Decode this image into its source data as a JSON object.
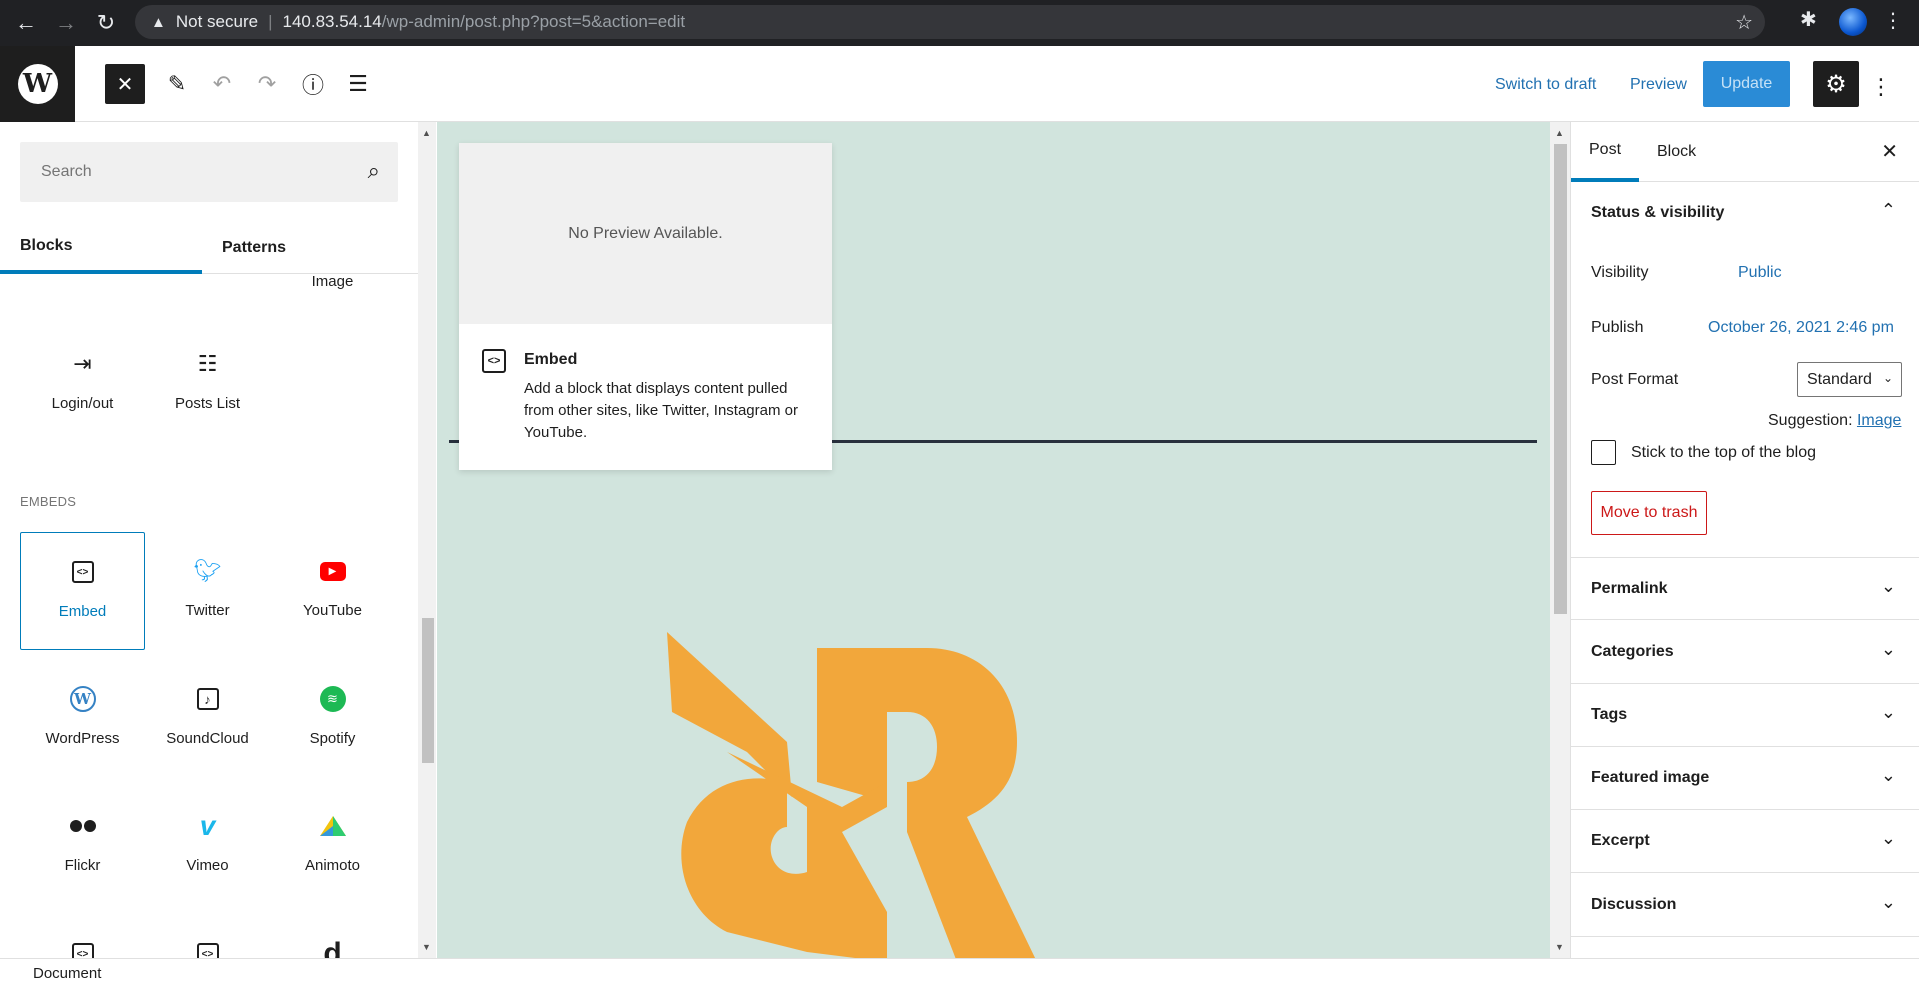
{
  "browser": {
    "security_label": "Not secure",
    "url_host": "140.83.54.14",
    "url_path": "/wp-admin/post.php?post=5&action=edit"
  },
  "header": {
    "switch_to_draft": "Switch to draft",
    "preview": "Preview",
    "update": "Update"
  },
  "inserter": {
    "search_placeholder": "Search",
    "tabs": [
      "Blocks",
      "Patterns"
    ],
    "partial_top_label": "Image",
    "widgets": [
      "Login/out",
      "Posts List"
    ],
    "section_embeds": "EMBEDS",
    "embed_blocks": [
      "Embed",
      "Twitter",
      "YouTube",
      "WordPress",
      "SoundCloud",
      "Spotify",
      "Flickr",
      "Vimeo",
      "Animoto"
    ]
  },
  "preview_card": {
    "no_preview": "No Preview Available.",
    "title": "Embed",
    "description": "Add a block that displays content pulled from other sites, like Twitter, Instagram or YouTube."
  },
  "settings": {
    "tabs": [
      "Post",
      "Block"
    ],
    "status_title": "Status & visibility",
    "visibility_label": "Visibility",
    "visibility_value": "Public",
    "publish_label": "Publish",
    "publish_value": "October 26, 2021 2:46 pm",
    "post_format_label": "Post Format",
    "post_format_value": "Standard",
    "suggestion_label": "Suggestion:",
    "suggestion_value": "Image",
    "sticky_label": "Stick to the top of the blog",
    "trash_label": "Move to trash",
    "panels": [
      "Permalink",
      "Categories",
      "Tags",
      "Featured image",
      "Excerpt",
      "Discussion"
    ]
  },
  "footer": {
    "breadcrumb": "Document"
  },
  "colors": {
    "accent": "#007cba",
    "canvas_bg": "#d1e4dd",
    "logo_orange": "#f2a73b",
    "danger": "#cc1818"
  }
}
